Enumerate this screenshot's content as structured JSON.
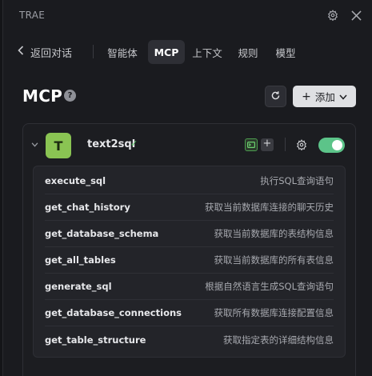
{
  "app": {
    "title": "TRAE"
  },
  "titlebar": {
    "icons": [
      "gear-icon",
      "close-icon"
    ]
  },
  "tabbar": {
    "back_label": "返回对话",
    "tabs": [
      {
        "label": "智能体",
        "active": false
      },
      {
        "label": "MCP",
        "active": true
      },
      {
        "label": "上下文",
        "active": false
      },
      {
        "label": "规则",
        "active": false
      },
      {
        "label": "模型",
        "active": false
      }
    ]
  },
  "header": {
    "title": "MCP",
    "help_glyph": "?",
    "add_button": "添加"
  },
  "server": {
    "avatar_letter": "T",
    "avatar_color": "#8ac453",
    "name": "text2sql",
    "status": "connected",
    "check_glyph": "✓",
    "enabled": true,
    "toggle_color": "#5cc489",
    "tools": [
      {
        "name": "execute_sql",
        "desc": "执行SQL查询语句"
      },
      {
        "name": "get_chat_history",
        "desc": "获取当前数据库连接的聊天历史"
      },
      {
        "name": "get_database_schema",
        "desc": "获取当前数据库的表结构信息"
      },
      {
        "name": "get_all_tables",
        "desc": "获取当前数据库的所有表信息"
      },
      {
        "name": "generate_sql",
        "desc": "根据自然语言生成SQL查询语句"
      },
      {
        "name": "get_database_connections",
        "desc": "获取所有数据库连接配置信息"
      },
      {
        "name": "get_table_structure",
        "desc": "获取指定表的详细结构信息"
      }
    ]
  }
}
